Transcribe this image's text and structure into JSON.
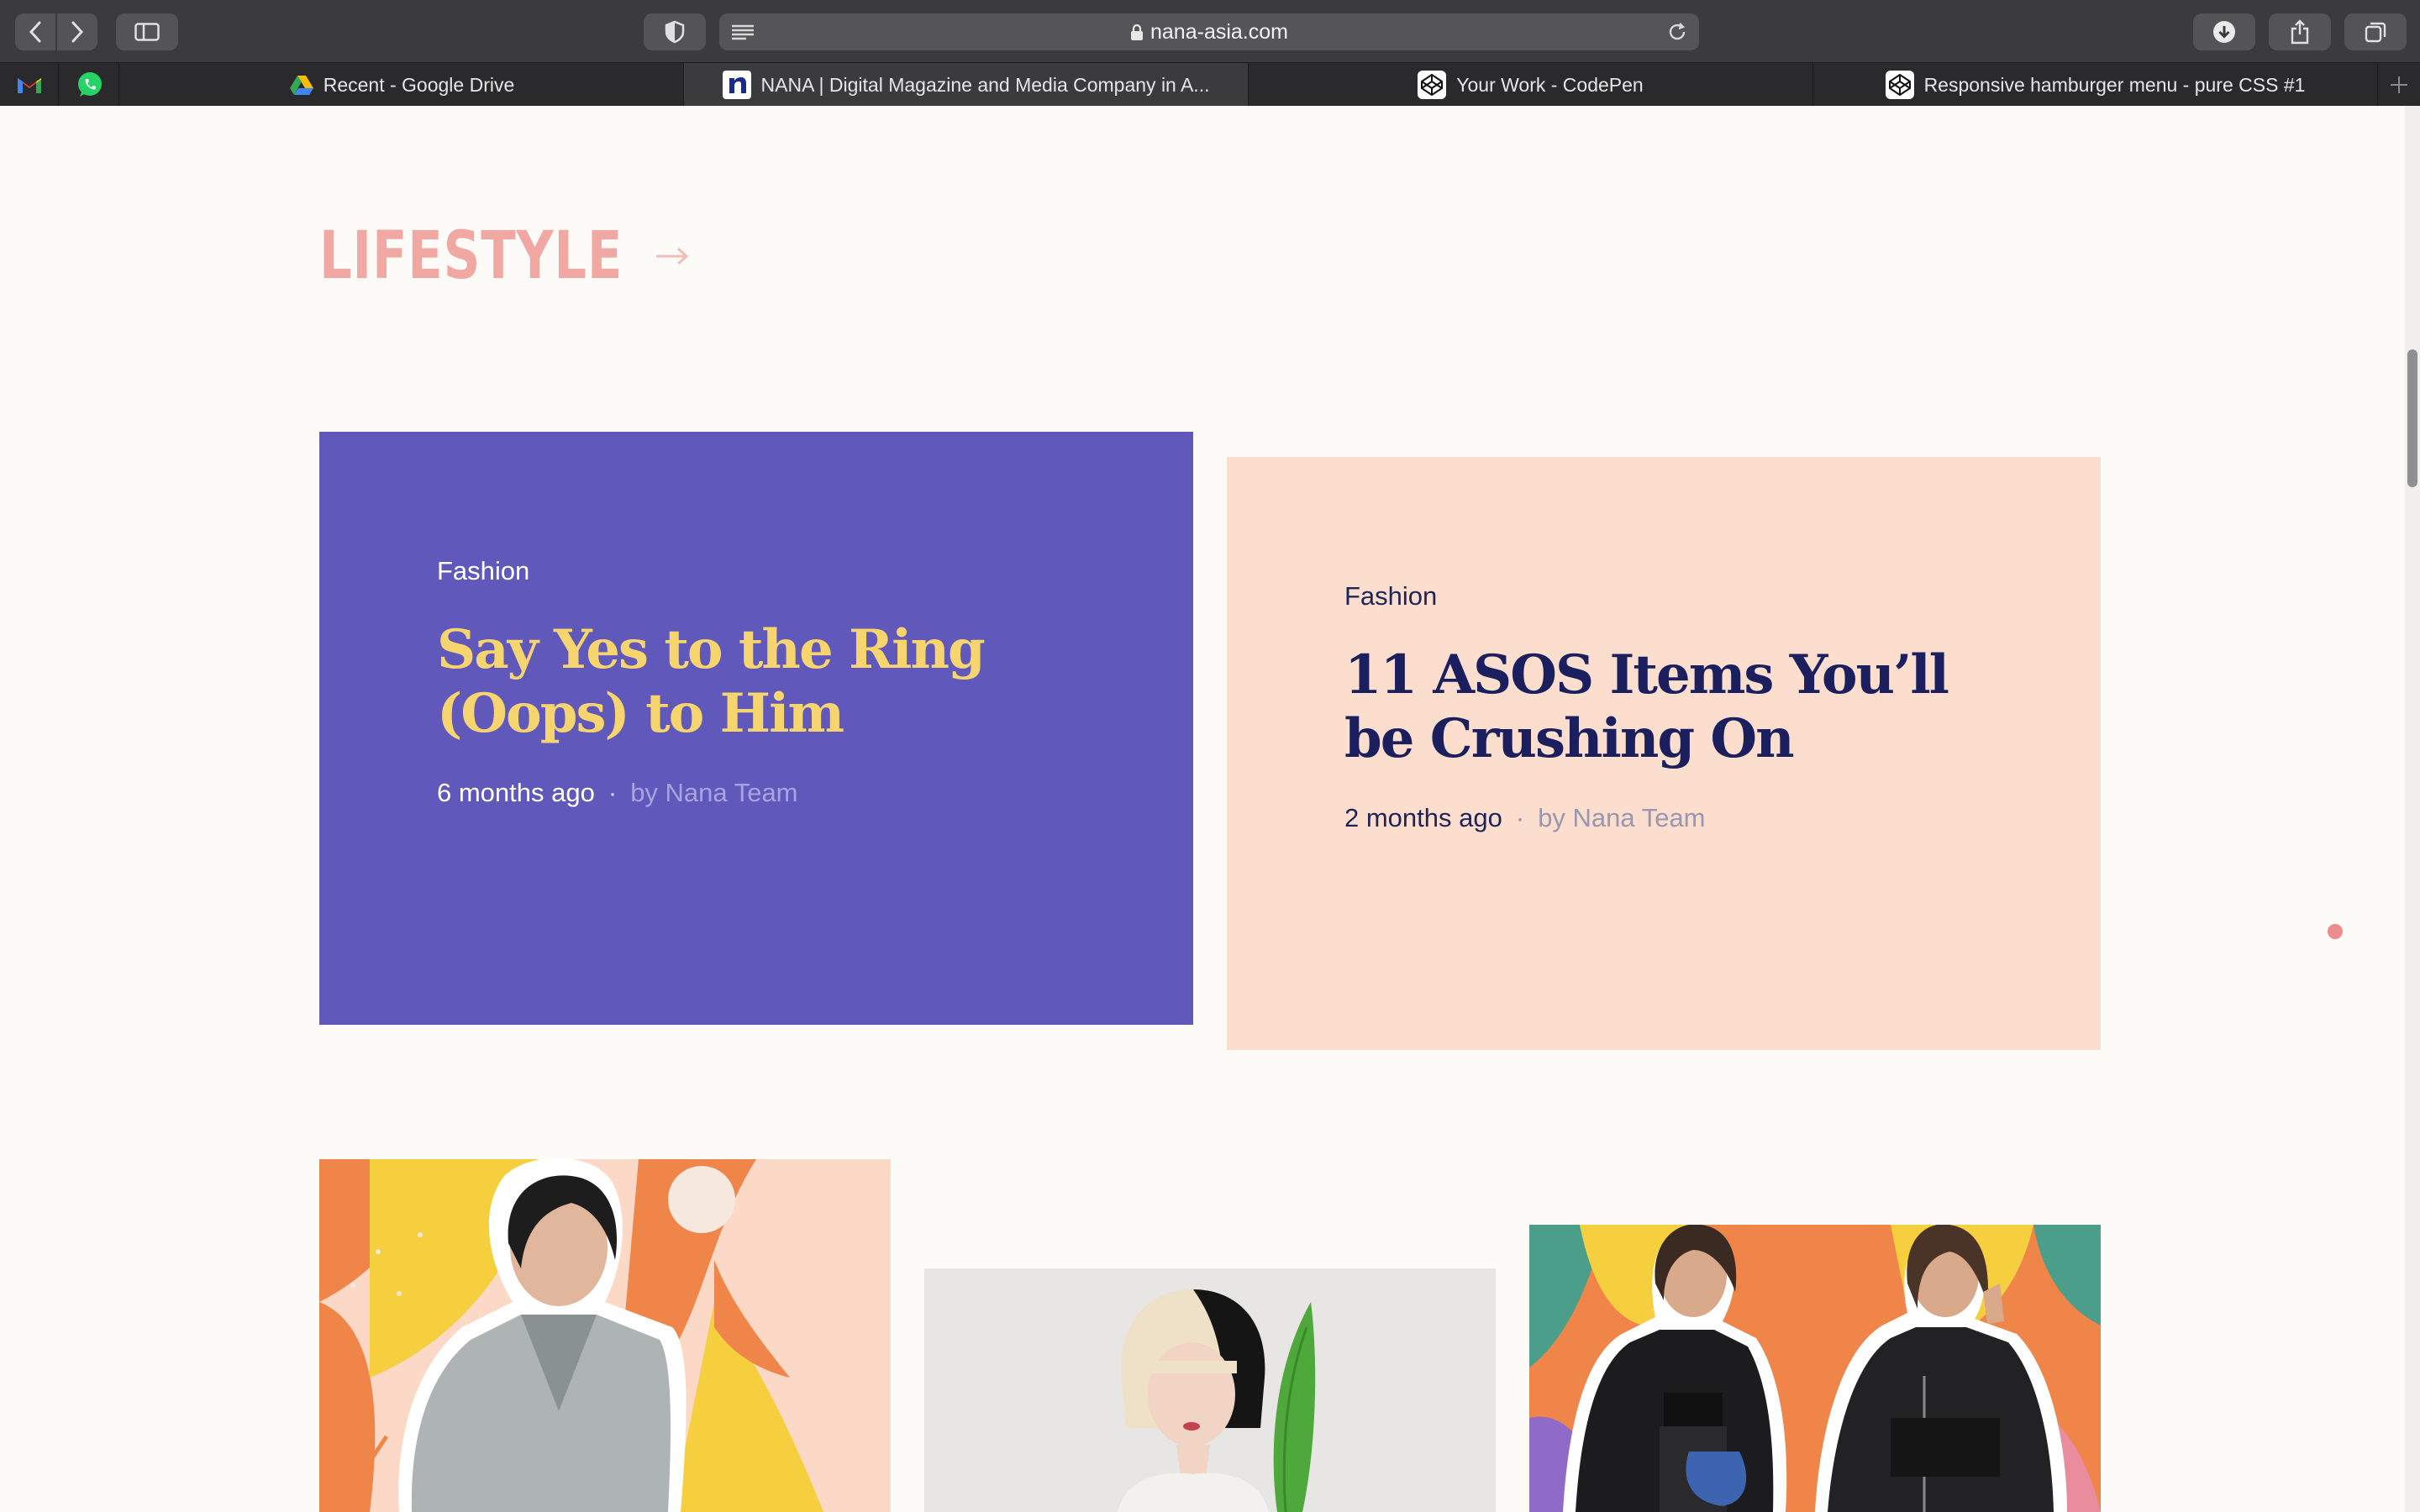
{
  "browser": {
    "url": "nana-asia.com",
    "pinned_tabs": [
      {
        "icon": "gmail-icon"
      },
      {
        "icon": "whatsapp-icon"
      }
    ],
    "tabs": [
      {
        "title": "Recent - Google Drive",
        "icon": "google-drive-icon",
        "active": false
      },
      {
        "title": "NANA | Digital Magazine and Media Company in A...",
        "icon": "nana-icon",
        "active": true
      },
      {
        "title": "Your Work - CodePen",
        "icon": "codepen-icon",
        "active": false
      },
      {
        "title": "Responsive hamburger menu - pure CSS #1",
        "icon": "codepen-icon",
        "active": false
      }
    ]
  },
  "section": {
    "title": "LIFESTYLE",
    "title_color": "#f1a7a2"
  },
  "featured": [
    {
      "category": "Fashion",
      "title": "Say Yes to the Ring (Oops) to Him",
      "time": "6 months ago",
      "separator": "·",
      "author": "by Nana Team",
      "bg": "#6059bb",
      "title_color": "#f7d56e"
    },
    {
      "category": "Fashion",
      "title": "11 ASOS Items You’ll be Crushing On",
      "time": "2 months ago",
      "separator": "·",
      "author": "by Nana Team",
      "bg": "#fbdece",
      "title_color": "#1b1f5e"
    }
  ],
  "thumbnails": [
    {
      "subject": "woman in grey kimono on colorful collage background"
    },
    {
      "subject": "woman with two-tone bob haircut beside green leaf"
    },
    {
      "subject": "two women in black bomber jackets on colorful collage background"
    }
  ]
}
